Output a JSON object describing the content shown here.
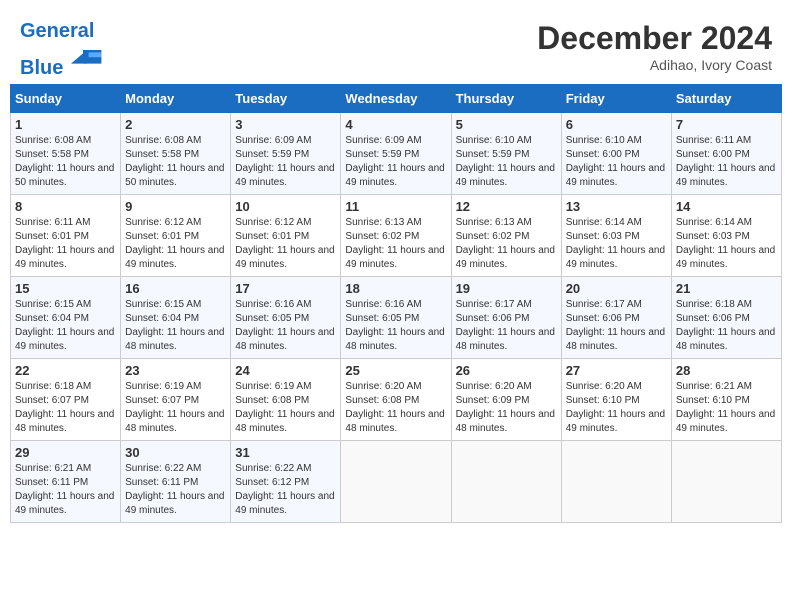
{
  "header": {
    "logo_line1": "General",
    "logo_line2": "Blue",
    "month_title": "December 2024",
    "location": "Adihao, Ivory Coast"
  },
  "weekdays": [
    "Sunday",
    "Monday",
    "Tuesday",
    "Wednesday",
    "Thursday",
    "Friday",
    "Saturday"
  ],
  "weeks": [
    [
      {
        "day": "1",
        "sunrise": "Sunrise: 6:08 AM",
        "sunset": "Sunset: 5:58 PM",
        "daylight": "Daylight: 11 hours and 50 minutes."
      },
      {
        "day": "2",
        "sunrise": "Sunrise: 6:08 AM",
        "sunset": "Sunset: 5:58 PM",
        "daylight": "Daylight: 11 hours and 50 minutes."
      },
      {
        "day": "3",
        "sunrise": "Sunrise: 6:09 AM",
        "sunset": "Sunset: 5:59 PM",
        "daylight": "Daylight: 11 hours and 49 minutes."
      },
      {
        "day": "4",
        "sunrise": "Sunrise: 6:09 AM",
        "sunset": "Sunset: 5:59 PM",
        "daylight": "Daylight: 11 hours and 49 minutes."
      },
      {
        "day": "5",
        "sunrise": "Sunrise: 6:10 AM",
        "sunset": "Sunset: 5:59 PM",
        "daylight": "Daylight: 11 hours and 49 minutes."
      },
      {
        "day": "6",
        "sunrise": "Sunrise: 6:10 AM",
        "sunset": "Sunset: 6:00 PM",
        "daylight": "Daylight: 11 hours and 49 minutes."
      },
      {
        "day": "7",
        "sunrise": "Sunrise: 6:11 AM",
        "sunset": "Sunset: 6:00 PM",
        "daylight": "Daylight: 11 hours and 49 minutes."
      }
    ],
    [
      {
        "day": "8",
        "sunrise": "Sunrise: 6:11 AM",
        "sunset": "Sunset: 6:01 PM",
        "daylight": "Daylight: 11 hours and 49 minutes."
      },
      {
        "day": "9",
        "sunrise": "Sunrise: 6:12 AM",
        "sunset": "Sunset: 6:01 PM",
        "daylight": "Daylight: 11 hours and 49 minutes."
      },
      {
        "day": "10",
        "sunrise": "Sunrise: 6:12 AM",
        "sunset": "Sunset: 6:01 PM",
        "daylight": "Daylight: 11 hours and 49 minutes."
      },
      {
        "day": "11",
        "sunrise": "Sunrise: 6:13 AM",
        "sunset": "Sunset: 6:02 PM",
        "daylight": "Daylight: 11 hours and 49 minutes."
      },
      {
        "day": "12",
        "sunrise": "Sunrise: 6:13 AM",
        "sunset": "Sunset: 6:02 PM",
        "daylight": "Daylight: 11 hours and 49 minutes."
      },
      {
        "day": "13",
        "sunrise": "Sunrise: 6:14 AM",
        "sunset": "Sunset: 6:03 PM",
        "daylight": "Daylight: 11 hours and 49 minutes."
      },
      {
        "day": "14",
        "sunrise": "Sunrise: 6:14 AM",
        "sunset": "Sunset: 6:03 PM",
        "daylight": "Daylight: 11 hours and 49 minutes."
      }
    ],
    [
      {
        "day": "15",
        "sunrise": "Sunrise: 6:15 AM",
        "sunset": "Sunset: 6:04 PM",
        "daylight": "Daylight: 11 hours and 49 minutes."
      },
      {
        "day": "16",
        "sunrise": "Sunrise: 6:15 AM",
        "sunset": "Sunset: 6:04 PM",
        "daylight": "Daylight: 11 hours and 48 minutes."
      },
      {
        "day": "17",
        "sunrise": "Sunrise: 6:16 AM",
        "sunset": "Sunset: 6:05 PM",
        "daylight": "Daylight: 11 hours and 48 minutes."
      },
      {
        "day": "18",
        "sunrise": "Sunrise: 6:16 AM",
        "sunset": "Sunset: 6:05 PM",
        "daylight": "Daylight: 11 hours and 48 minutes."
      },
      {
        "day": "19",
        "sunrise": "Sunrise: 6:17 AM",
        "sunset": "Sunset: 6:06 PM",
        "daylight": "Daylight: 11 hours and 48 minutes."
      },
      {
        "day": "20",
        "sunrise": "Sunrise: 6:17 AM",
        "sunset": "Sunset: 6:06 PM",
        "daylight": "Daylight: 11 hours and 48 minutes."
      },
      {
        "day": "21",
        "sunrise": "Sunrise: 6:18 AM",
        "sunset": "Sunset: 6:06 PM",
        "daylight": "Daylight: 11 hours and 48 minutes."
      }
    ],
    [
      {
        "day": "22",
        "sunrise": "Sunrise: 6:18 AM",
        "sunset": "Sunset: 6:07 PM",
        "daylight": "Daylight: 11 hours and 48 minutes."
      },
      {
        "day": "23",
        "sunrise": "Sunrise: 6:19 AM",
        "sunset": "Sunset: 6:07 PM",
        "daylight": "Daylight: 11 hours and 48 minutes."
      },
      {
        "day": "24",
        "sunrise": "Sunrise: 6:19 AM",
        "sunset": "Sunset: 6:08 PM",
        "daylight": "Daylight: 11 hours and 48 minutes."
      },
      {
        "day": "25",
        "sunrise": "Sunrise: 6:20 AM",
        "sunset": "Sunset: 6:08 PM",
        "daylight": "Daylight: 11 hours and 48 minutes."
      },
      {
        "day": "26",
        "sunrise": "Sunrise: 6:20 AM",
        "sunset": "Sunset: 6:09 PM",
        "daylight": "Daylight: 11 hours and 48 minutes."
      },
      {
        "day": "27",
        "sunrise": "Sunrise: 6:20 AM",
        "sunset": "Sunset: 6:10 PM",
        "daylight": "Daylight: 11 hours and 49 minutes."
      },
      {
        "day": "28",
        "sunrise": "Sunrise: 6:21 AM",
        "sunset": "Sunset: 6:10 PM",
        "daylight": "Daylight: 11 hours and 49 minutes."
      }
    ],
    [
      {
        "day": "29",
        "sunrise": "Sunrise: 6:21 AM",
        "sunset": "Sunset: 6:11 PM",
        "daylight": "Daylight: 11 hours and 49 minutes."
      },
      {
        "day": "30",
        "sunrise": "Sunrise: 6:22 AM",
        "sunset": "Sunset: 6:11 PM",
        "daylight": "Daylight: 11 hours and 49 minutes."
      },
      {
        "day": "31",
        "sunrise": "Sunrise: 6:22 AM",
        "sunset": "Sunset: 6:12 PM",
        "daylight": "Daylight: 11 hours and 49 minutes."
      },
      null,
      null,
      null,
      null
    ]
  ]
}
